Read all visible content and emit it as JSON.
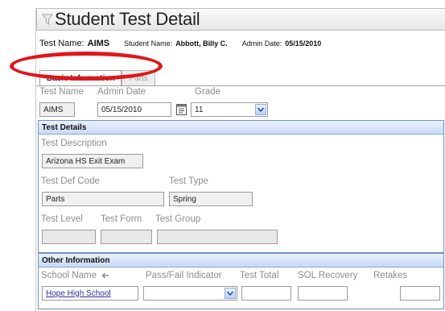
{
  "window": {
    "title": "Student Test Detail"
  },
  "header": {
    "test_name_label": "Test Name:",
    "test_name_value": "AIMS",
    "student_name_label": "Student Name:",
    "student_name_value": "Abbott, Billy C.",
    "admin_date_label": "Admin Date:",
    "admin_date_value": "05/15/2010"
  },
  "tabs": [
    {
      "label": "Basic Information",
      "active": true
    },
    {
      "label": "Parts",
      "active": false
    }
  ],
  "basic": {
    "test_name_label": "Test Name",
    "admin_date_label": "Admin Date",
    "grade_label": "Grade",
    "test_name_value": "AIMS",
    "admin_date_value": "05/15/2010",
    "grade_value": "11"
  },
  "test_details": {
    "header": "Test Details",
    "description_label": "Test Description",
    "description_value": "Arizona HS Exit Exam",
    "def_code_label": "Test Def Code",
    "def_code_value": "Parts",
    "test_type_label": "Test Type",
    "test_type_value": "Spring",
    "level_label": "Test Level",
    "form_label": "Test Form",
    "group_label": "Test Group",
    "level_value": "",
    "form_value": "",
    "group_value": ""
  },
  "other_info": {
    "header": "Other Information",
    "school_label": "School Name",
    "school_value": "Hope High School",
    "passfail_label": "Pass/Fail Indicator",
    "passfail_value": "",
    "test_total_label": "Test Total",
    "test_total_value": "",
    "sol_label": "SOL Recovery",
    "sol_value": "",
    "retakes_label": "Retakes",
    "retakes_value": ""
  },
  "icons": {
    "title": "funnel-icon",
    "calendar": "calendar-icon",
    "dropdown": "chevron-down-icon",
    "school_nav": "arrow-left-icon"
  },
  "colors": {
    "section_border": "#6f8fc4",
    "section_header": "#c9daf6",
    "annotation": "#e0161b",
    "link": "#2d2d9f"
  }
}
